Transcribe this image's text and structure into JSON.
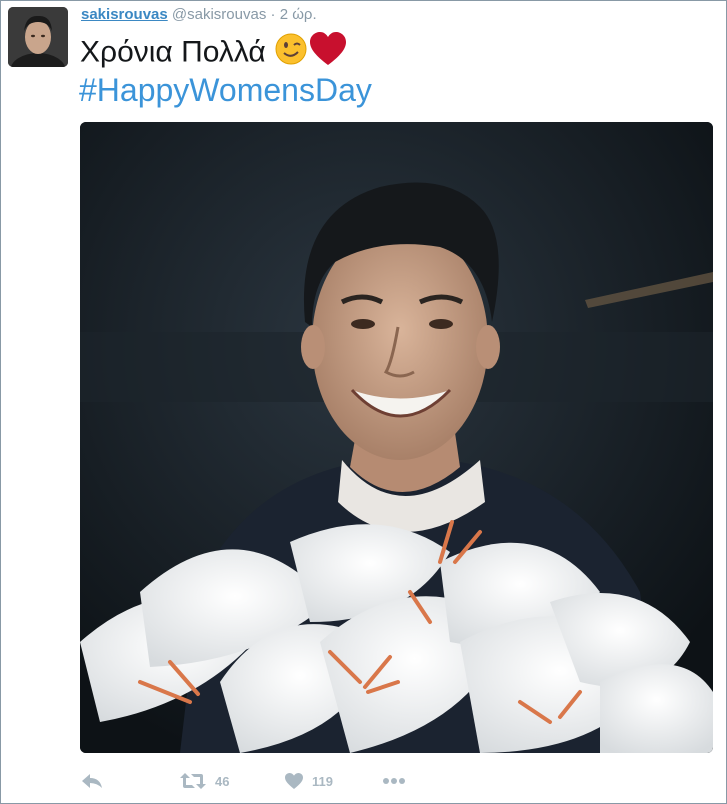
{
  "user": {
    "display_name": "sakisrouvas",
    "handle": "@sakisrouvas",
    "separator": "·",
    "timestamp": "2 ώρ."
  },
  "tweet": {
    "text": "Χρόνια Πολλά",
    "emojis": [
      "winking-face-icon",
      "red-heart-icon"
    ],
    "hashtag": "#HappyWomensDay"
  },
  "media": {
    "description_icon": "photo-man-with-white-lilies"
  },
  "actions": {
    "reply_icon": "reply-icon",
    "retweet_icon": "retweet-icon",
    "retweet_count": "46",
    "like_icon": "heart-icon",
    "like_count": "119",
    "more_icon": "more-icon"
  },
  "colors": {
    "link": "#3b88c3",
    "hashtag": "#3b94d9",
    "muted": "#8899a6",
    "action": "#aab8c2"
  }
}
